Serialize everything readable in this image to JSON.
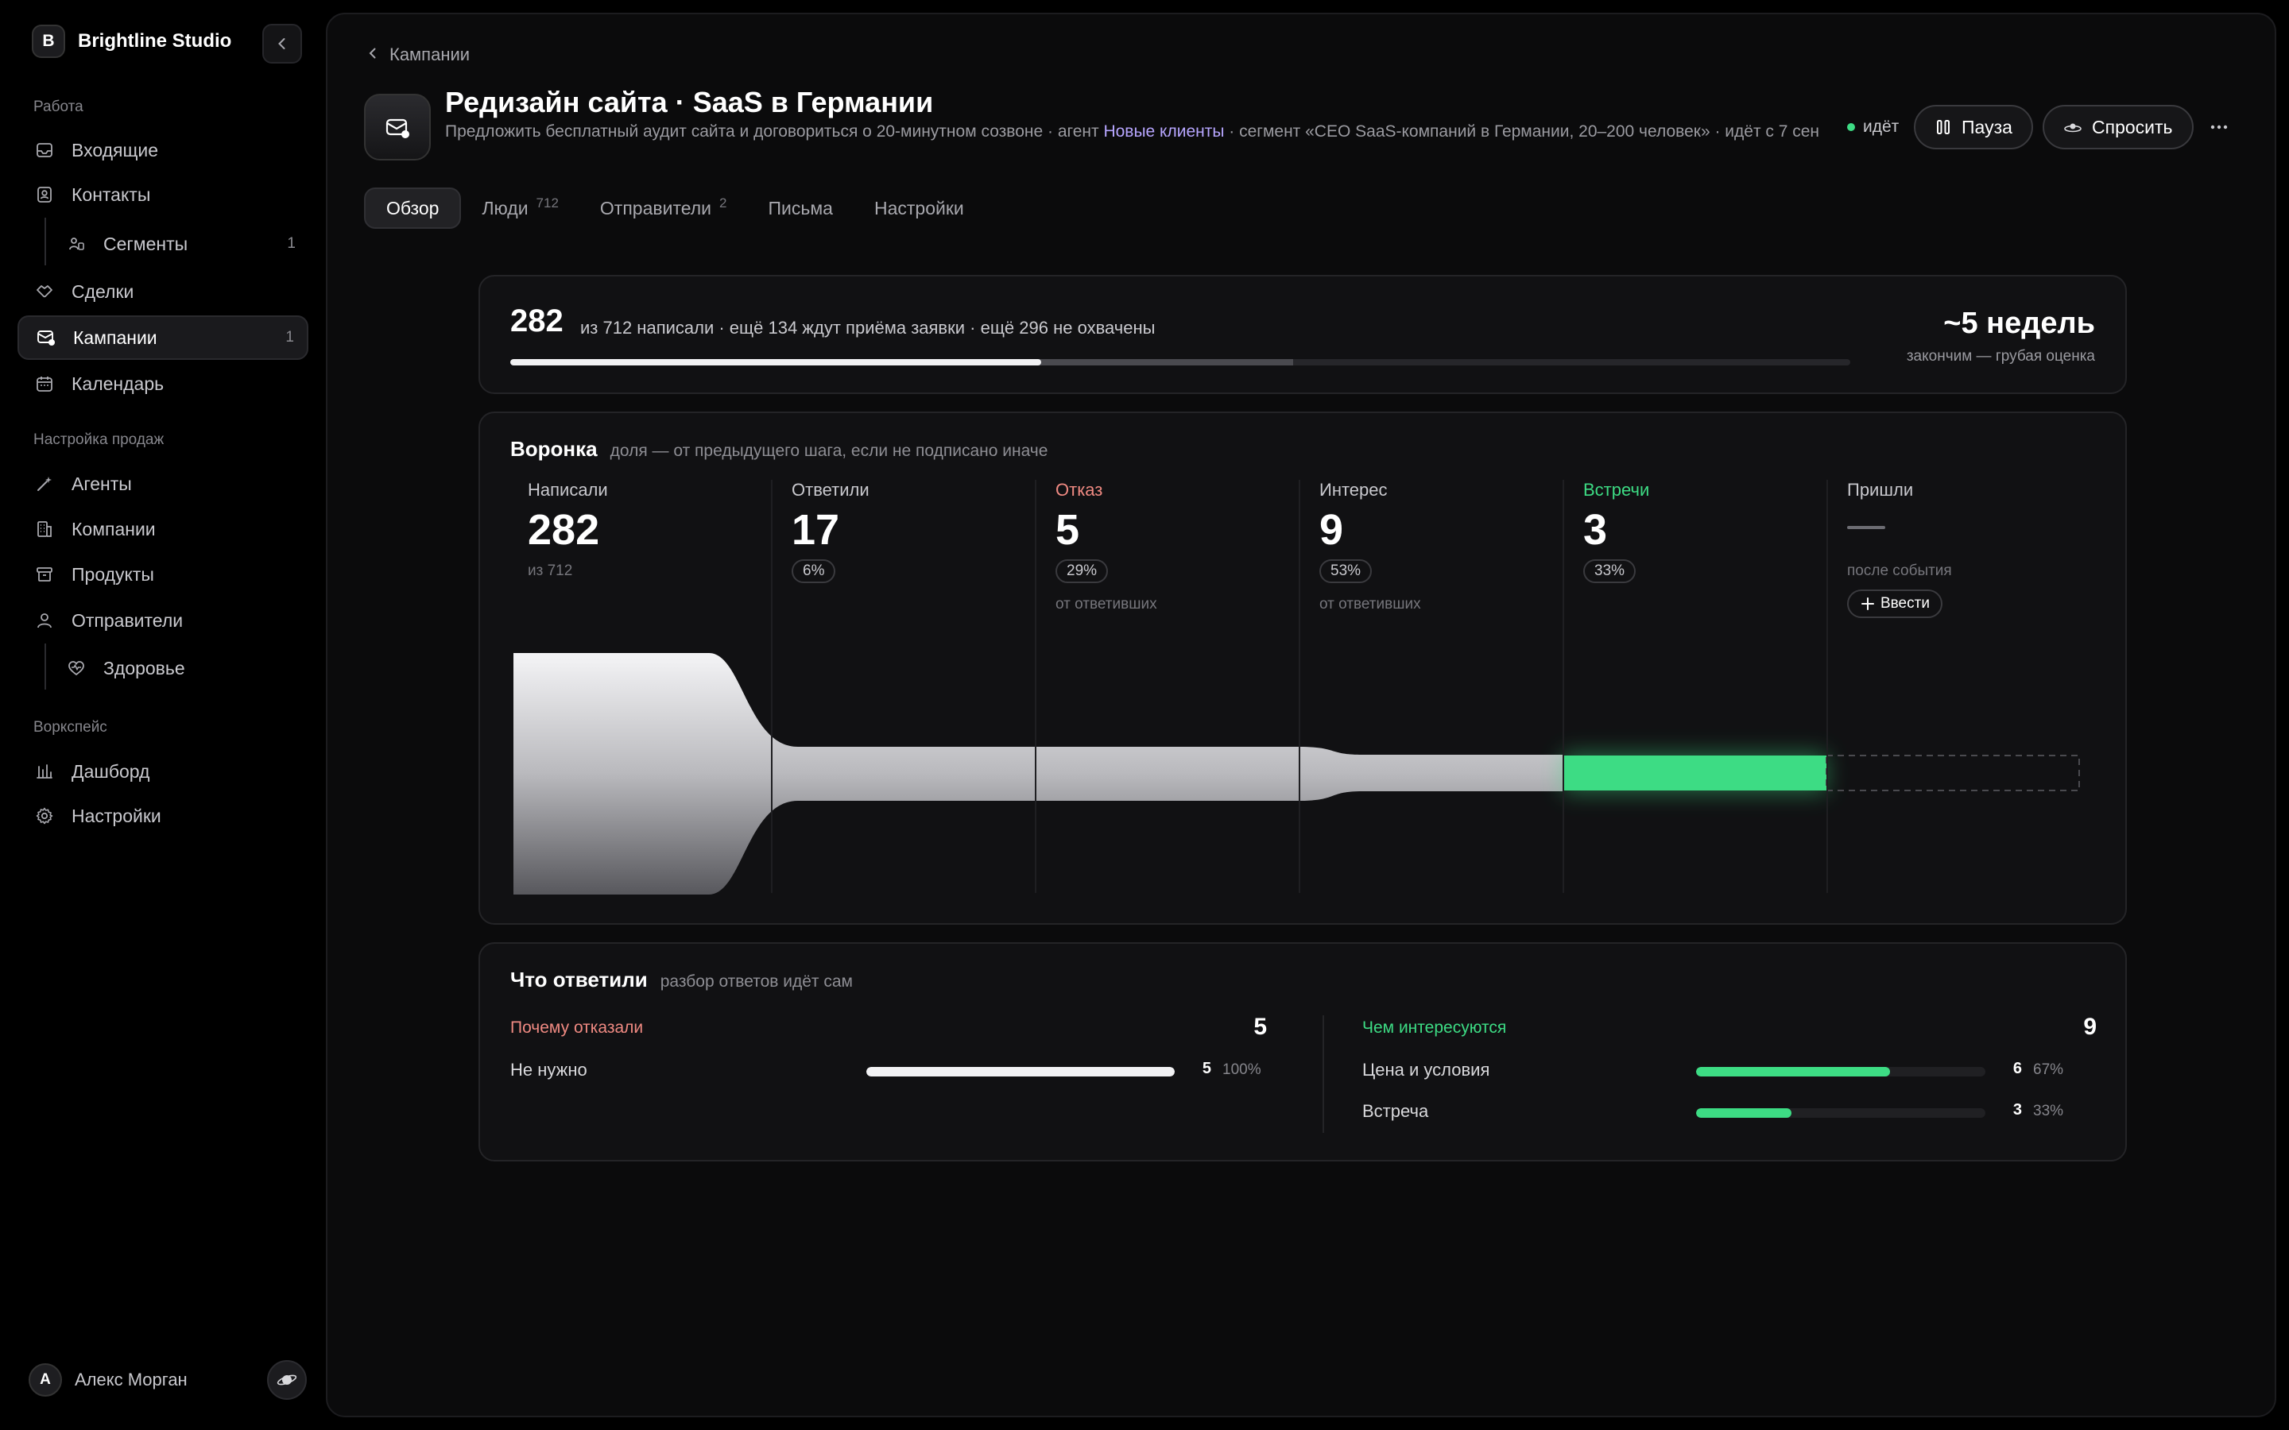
{
  "workspace": {
    "initial": "B",
    "name": "Brightline Studio"
  },
  "sidebar": {
    "sections": [
      {
        "label": "Работа"
      },
      {
        "label": "Настройка продаж"
      },
      {
        "label": "Воркспейс"
      }
    ],
    "items": [
      {
        "label": "Входящие",
        "icon": "inbox-icon"
      },
      {
        "label": "Контакты",
        "icon": "contacts-icon"
      },
      {
        "label": "Сегменты",
        "icon": "segments-icon",
        "badge": "1"
      },
      {
        "label": "Сделки",
        "icon": "handshake-icon"
      },
      {
        "label": "Кампании",
        "icon": "campaign-icon",
        "badge": "1",
        "active": true
      },
      {
        "label": "Календарь",
        "icon": "calendar-icon"
      },
      {
        "label": "Агенты",
        "icon": "wand-icon"
      },
      {
        "label": "Компании",
        "icon": "building-icon"
      },
      {
        "label": "Продукты",
        "icon": "box-icon"
      },
      {
        "label": "Отправители",
        "icon": "user-icon"
      },
      {
        "label": "Здоровье",
        "icon": "heart-pulse-icon"
      },
      {
        "label": "Дашборд",
        "icon": "chart-icon"
      },
      {
        "label": "Настройки",
        "icon": "gear-icon"
      }
    ],
    "user": {
      "initial": "A",
      "name": "Алекс Морган"
    }
  },
  "header": {
    "breadcrumb": "Кампании",
    "title": "Редизайн сайта · SaaS в Германии",
    "subtitle_pre": "Предложить бесплатный аудит сайта и договориться о 20-минутном созвоне · агент ",
    "subtitle_agent": "Новые клиенты",
    "subtitle_post": " · сегмент «CEO SaaS-компаний в Германии, 20–200 человек» · идёт с 7 сен",
    "status": "идёт",
    "pause_label": "Пауза",
    "ask_label": "Спросить"
  },
  "tabs": [
    {
      "label": "Обзор",
      "active": true
    },
    {
      "label": "Люди",
      "count": "712"
    },
    {
      "label": "Отправители",
      "count": "2"
    },
    {
      "label": "Письма"
    },
    {
      "label": "Настройки"
    }
  ],
  "progress": {
    "count": "282",
    "text": "из 712 написали · ещё 134 ждут приёма заявки · ещё 296 не охвачены",
    "total": 712,
    "done": 282,
    "pending": 134,
    "eta": "~5 недель",
    "eta_note": "закончим — грубая оценка"
  },
  "funnel": {
    "title": "Воронка",
    "subtitle": "доля — от предыдущего шага, если не подписано иначе",
    "stages": [
      {
        "label": "Написали",
        "value": "282",
        "note": "из 712",
        "tone": "default"
      },
      {
        "label": "Ответили",
        "value": "17",
        "pct": "6%",
        "tone": "default"
      },
      {
        "label": "Отказ",
        "value": "5",
        "pct": "29%",
        "note": "от ответивших",
        "tone": "red"
      },
      {
        "label": "Интерес",
        "value": "9",
        "pct": "53%",
        "note": "от ответивших",
        "tone": "default"
      },
      {
        "label": "Встречи",
        "value": "3",
        "pct": "33%",
        "tone": "green"
      },
      {
        "label": "Пришли",
        "note": "после события",
        "button": "Ввести",
        "tone": "default"
      }
    ]
  },
  "replies": {
    "title": "Что ответили",
    "subtitle": "разбор ответов идёт сам",
    "rejections": {
      "label": "Почему отказали",
      "total": "5",
      "rows": [
        {
          "label": "Не нужно",
          "value": "5",
          "pct": "100%",
          "fraction": 1.0
        }
      ]
    },
    "interests": {
      "label": "Чем интересуются",
      "total": "9",
      "rows": [
        {
          "label": "Цена и условия",
          "value": "6",
          "pct": "67%",
          "fraction": 0.67
        },
        {
          "label": "Встреча",
          "value": "3",
          "pct": "33%",
          "fraction": 0.33
        }
      ]
    }
  },
  "colors": {
    "accent_green": "#3ddc84",
    "accent_red": "#f08a82",
    "agent_link": "#b7a6ff"
  }
}
